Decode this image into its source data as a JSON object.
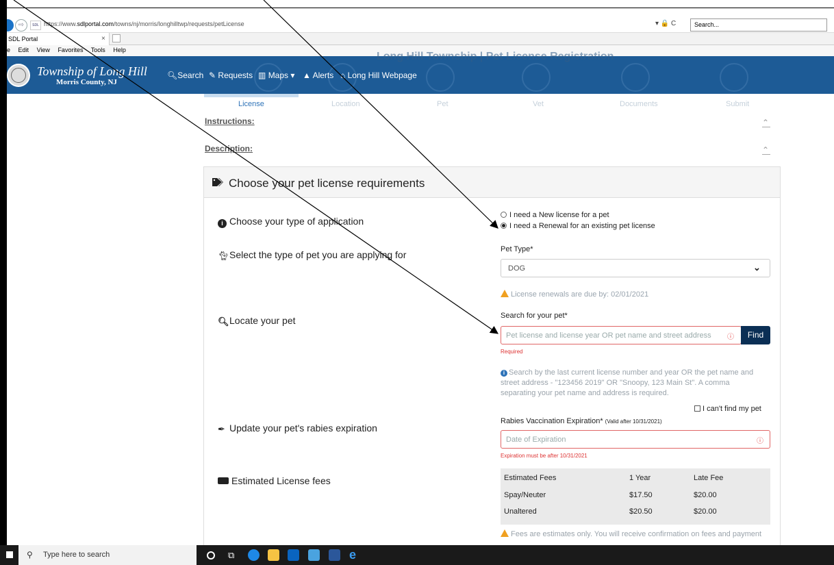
{
  "browser": {
    "url_prefix": "https://www.",
    "url_domain": "sdlportal.com",
    "url_path": "/towns/nj/morris/longhilltwp/requests/petLicense",
    "site_icon_text": "SDL",
    "search_placeholder": "Search...",
    "lock_text": "▾ 🔒 C",
    "tab_title": "SDL Portal",
    "tab_close": "×",
    "menu": [
      "e",
      "Edit",
      "View",
      "Favorites",
      "Tools",
      "Help"
    ]
  },
  "header": {
    "ghost_title": "Long Hill Township | Pet License Registration",
    "brand_line1": "Township of Long Hill",
    "brand_line2": "Morris County, NJ",
    "nav": {
      "search": "Search",
      "requests": "Requests",
      "maps": "Maps ▾",
      "alerts": "Alerts",
      "webpage": "Long Hill Webpage"
    }
  },
  "stepper": {
    "steps": [
      "License",
      "Location",
      "Pet",
      "Vet",
      "Documents",
      "Submit"
    ]
  },
  "sections": {
    "instructions": "Instructions:",
    "description": "Description:",
    "chevron": "⌃"
  },
  "card": {
    "title": "Choose your pet license requirements",
    "application_label": "Choose your type of application",
    "radio_new": "I need a New license for a pet",
    "radio_renewal": "I need a Renewal for an existing pet license",
    "pet_type_question": "Select the type of pet you are applying for",
    "pet_type_label": "Pet Type*",
    "pet_type_value": "DOG",
    "renewal_warning": "License renewals are due by: 02/01/2021",
    "locate_label": "Locate your pet",
    "search_label": "Search for your pet*",
    "search_placeholder": "Pet license and license year OR pet name and street address",
    "find_button": "Find",
    "required_msg": "Required",
    "search_help": "Search by the last current license number and year OR the pet name and street address - \"123456 2019\" OR \"Snoopy, 123 Main St\". A comma separating your pet name and address is required.",
    "cant_find": "I can't find my pet",
    "rabies_question": "Update your pet's rabies expiration",
    "rabies_label": "Rabies Vaccination Expiration*",
    "rabies_valid": "(Valid after 10/31/2021)",
    "rabies_placeholder": "Date of Expiration",
    "rabies_error": "Expiration must be after 10/31/2021",
    "fees_label": "Estimated License fees",
    "fees": {
      "headers": [
        "Estimated Fees",
        "1 Year",
        "Late Fee"
      ],
      "rows": [
        [
          "Spay/Neuter",
          "$17.50",
          "$20.00"
        ],
        [
          "Unaltered",
          "$20.50",
          "$20.00"
        ]
      ]
    },
    "fees_warning": "Fees are estimates only. You will receive confirmation on fees and payment"
  },
  "taskbar": {
    "search_text": "Type here to search"
  },
  "colors": {
    "header_bg": "#1d5b96",
    "accent": "#2e73b8",
    "find_btn": "#0b2f55",
    "error": "#e06666",
    "warning": "#f0a020"
  }
}
